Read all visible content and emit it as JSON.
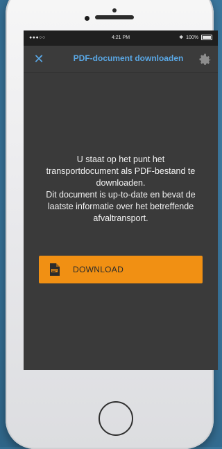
{
  "status_bar": {
    "carrier": "●●●○○",
    "time": "4:21 PM",
    "battery": "100%"
  },
  "nav": {
    "title": "PDF-document downloaden",
    "close_glyph": "✕"
  },
  "message_lines": [
    "U staat op het punt het",
    "transportdocument als PDF-bestand te",
    "downloaden.",
    "Dit document is up-to-date en bevat de",
    "laatste informatie over het betreffende",
    "afvaltransport."
  ],
  "download_button": {
    "label": "DOWNLOAD",
    "color": "#f19013"
  },
  "icons": {
    "close": "close-icon",
    "settings": "gear-icon",
    "pdf": "pdf-icon"
  }
}
